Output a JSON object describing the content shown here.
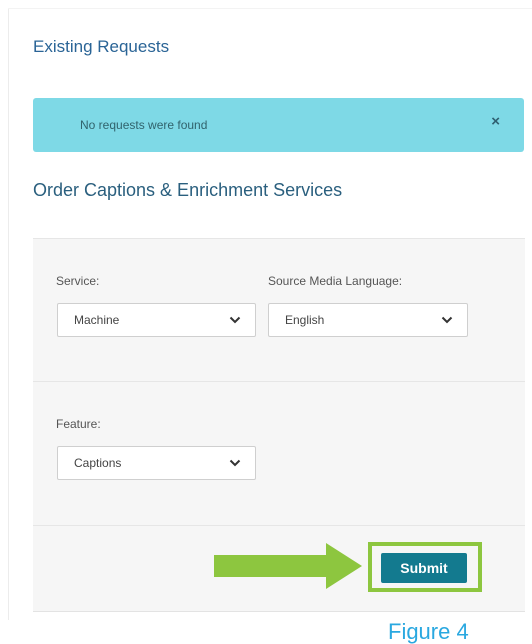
{
  "existing_requests": {
    "title": "Existing Requests",
    "alert_message": "No requests were found",
    "alert_close": "×"
  },
  "order": {
    "title": "Order Captions & Enrichment Services",
    "service": {
      "label": "Service:",
      "selected": "Machine"
    },
    "source_language": {
      "label": "Source Media Language:",
      "selected": "English"
    },
    "feature": {
      "label": "Feature:",
      "selected": "Captions"
    },
    "submit_label": "Submit"
  },
  "annotation": {
    "arrow_color": "#8dc63f",
    "highlight_color": "#8dc63f",
    "caption_partial": "Figure 4"
  },
  "colors": {
    "heading": "#2a6496",
    "alert_bg": "#7ed9e6",
    "submit_bg": "#137a8f",
    "panel_bg": "#f6f6f6"
  },
  "icons": {
    "alert_close": "close-icon",
    "dropdown": "chevron-down-icon",
    "annotation_arrow": "arrow-right-icon"
  }
}
